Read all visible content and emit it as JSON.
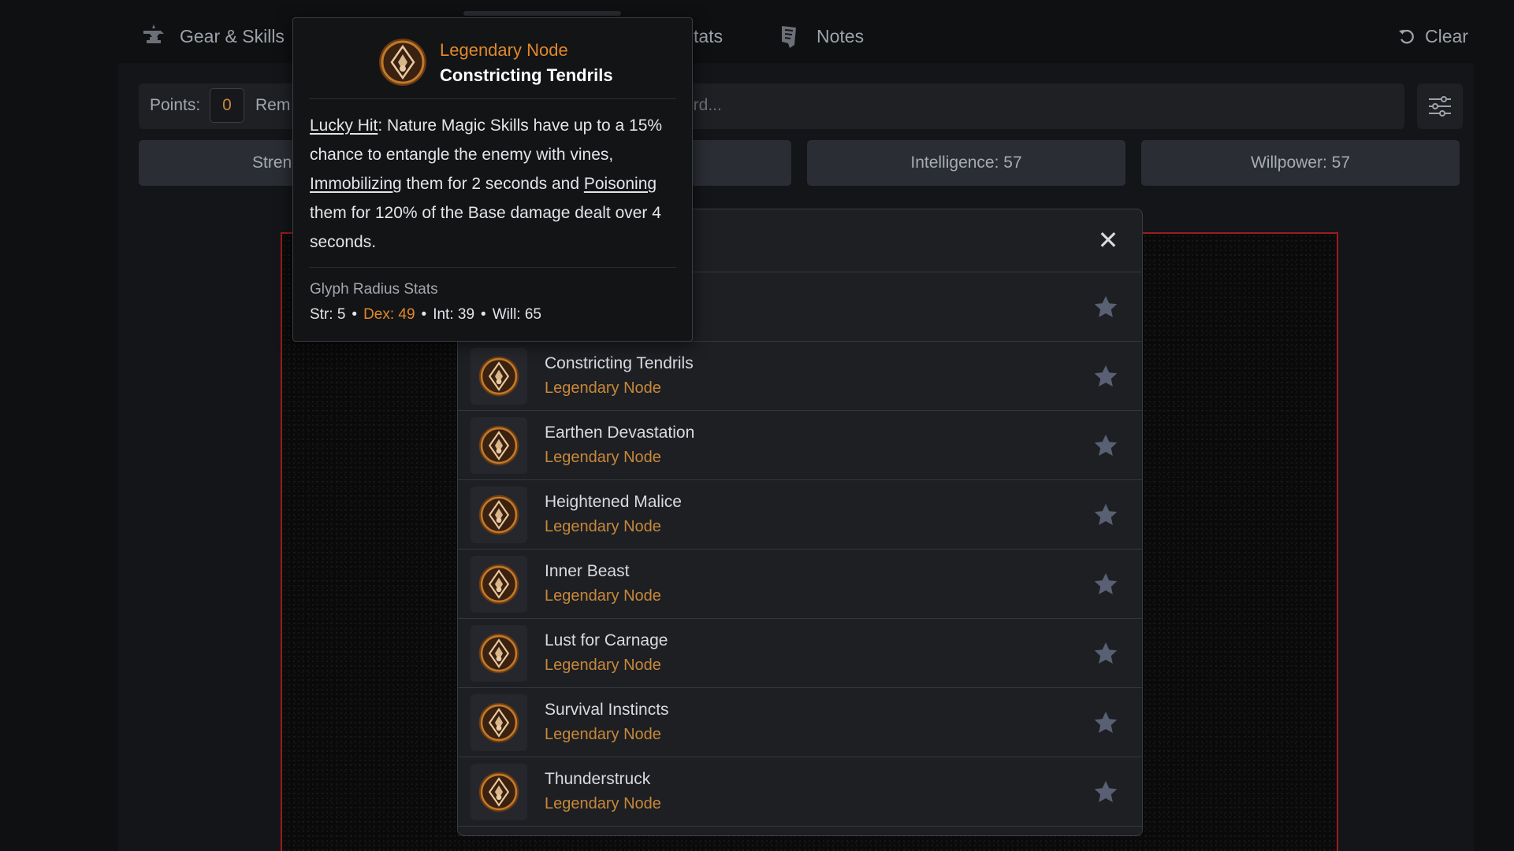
{
  "nav": {
    "gear_label": "Gear & Skills",
    "stats_label": "tats",
    "notes_label": "Notes",
    "clear_label": "Clear"
  },
  "points": {
    "label": "Points:",
    "value": "0",
    "remaining_label": "Rem",
    "search_placeholder": "ord..."
  },
  "stats": {
    "strength": "Stren",
    "intelligence": "Intelligence: 57",
    "willpower": "Willpower: 57"
  },
  "modal": {
    "close": "✕",
    "items": [
      {
        "title": "",
        "subtitle": ""
      },
      {
        "title": "Constricting Tendrils",
        "subtitle": "Legendary Node"
      },
      {
        "title": "Earthen Devastation",
        "subtitle": "Legendary Node"
      },
      {
        "title": "Heightened Malice",
        "subtitle": "Legendary Node"
      },
      {
        "title": "Inner Beast",
        "subtitle": "Legendary Node"
      },
      {
        "title": "Lust for Carnage",
        "subtitle": "Legendary Node"
      },
      {
        "title": "Survival Instincts",
        "subtitle": "Legendary Node"
      },
      {
        "title": "Thunderstruck",
        "subtitle": "Legendary Node"
      }
    ]
  },
  "tooltip": {
    "type": "Legendary Node",
    "name": "Constricting Tendrils",
    "desc": {
      "k1": "Lucky Hit",
      "t1": ": Nature Magic Skills have up to a 15% chance to entangle the enemy with vines, ",
      "k2": "Immobilizing",
      "t2": " them for 2 seconds and ",
      "k3": "Poisoning",
      "t3": " them for 120% of the Base damage dealt over 4 seconds."
    },
    "radius_label": "Glyph Radius Stats",
    "radius": {
      "str": "Str: 5",
      "dex": "Dex: 49",
      "int": "Int: 39",
      "will": "Will: 65",
      "sep": "•"
    }
  },
  "colors": {
    "accent": "#e0882c",
    "board_border": "#9b1d1d"
  }
}
